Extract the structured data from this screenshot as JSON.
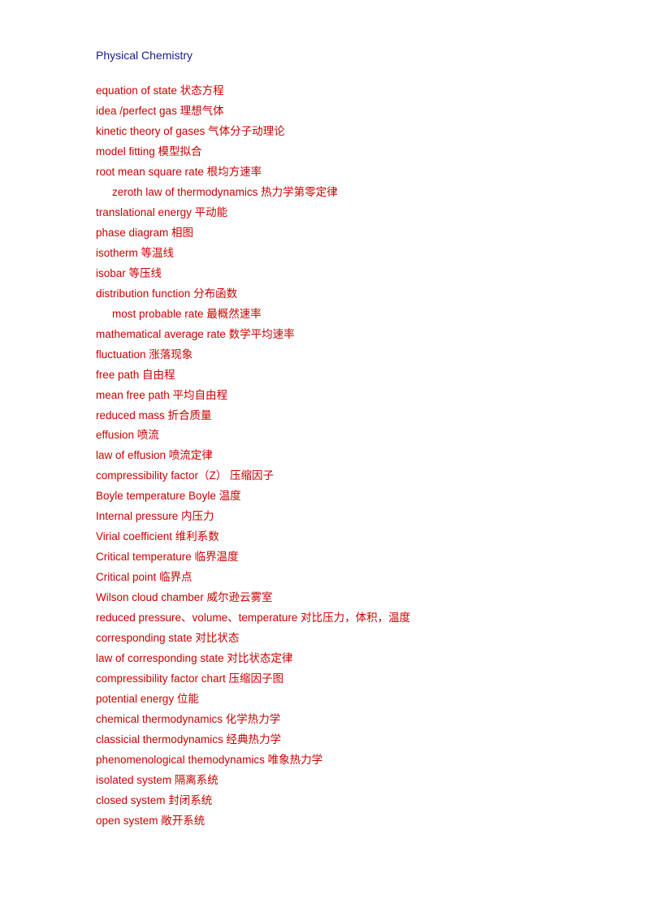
{
  "page": {
    "title": "Physical Chemistry"
  },
  "terms": [
    {
      "en": "equation of state",
      "zh": "状态方程",
      "indent": false,
      "spacing": "wide"
    },
    {
      "en": "idea /perfect gas",
      "zh": "理想气体",
      "indent": false
    },
    {
      "en": "kinetic theory of gases",
      "zh": "气体分子动理论",
      "indent": false
    },
    {
      "en": "model fitting",
      "zh": "模型拟合",
      "indent": false
    },
    {
      "en": "root mean square rate",
      "zh": "根均方速率",
      "indent": false
    },
    {
      "en": "  zeroth law of thermodynamics",
      "zh": "热力学第零定律",
      "indent": true
    },
    {
      "en": "translational energy",
      "zh": "平动能",
      "indent": false
    },
    {
      "en": "phase diagram",
      "zh": "相图",
      "indent": false
    },
    {
      "en": "isotherm",
      "zh": "等温线",
      "indent": false
    },
    {
      "en": "isobar",
      "zh": "等压线",
      "indent": false
    },
    {
      "en": "distribution function",
      "zh": "分布函数",
      "indent": false
    },
    {
      "en": "  most probable rate",
      "zh": "最概然速率",
      "indent": true
    },
    {
      "en": "mathematical average rate",
      "zh": "数学平均速率",
      "indent": false
    },
    {
      "en": "fluctuation",
      "zh": "涨落现象",
      "indent": false
    },
    {
      "en": "free path",
      "zh": "自由程",
      "indent": false
    },
    {
      "en": "mean free path",
      "zh": "平均自由程",
      "indent": false
    },
    {
      "en": "reduced mass",
      "zh": "折合质量",
      "indent": false
    },
    {
      "en": "effusion",
      "zh": "喷流",
      "indent": false
    },
    {
      "en": "law of effusion",
      "zh": "喷流定律",
      "indent": false
    },
    {
      "en": "compressibility factor（Z）",
      "zh": "压缩因子",
      "indent": false
    },
    {
      "en": "Boyle temperature",
      "zh": "Boyle 温度",
      "indent": false,
      "spacing": "wide"
    },
    {
      "en": "Internal pressure",
      "zh": "内压力",
      "indent": false
    },
    {
      "en": "Virial coefficient",
      "zh": "维利系数",
      "indent": false
    },
    {
      "en": "Critical temperature",
      "zh": "临界温度",
      "indent": false
    },
    {
      "en": "Critical point",
      "zh": "临界点",
      "indent": false
    },
    {
      "en": "Wilson cloud chamber",
      "zh": "威尔逊云雾室",
      "indent": false
    },
    {
      "en": "reduced pressure、volume、temperature",
      "zh": "对比压力，体积，温度",
      "indent": false
    },
    {
      "en": "corresponding    state",
      "zh": "对比状态",
      "indent": false
    },
    {
      "en": "law of corresponding state",
      "zh": "对比状态定律",
      "indent": false
    },
    {
      "en": "compressibility factor chart",
      "zh": "压缩因子图",
      "indent": false
    },
    {
      "en": "potential energy",
      "zh": "位能",
      "indent": false
    },
    {
      "en": "chemical    thermodynamics",
      "zh": "化学热力学",
      "indent": false
    },
    {
      "en": "classicial thermodynamics",
      "zh": "经典热力学",
      "indent": false
    },
    {
      "en": "phenomenological themodynamics",
      "zh": "唯象热力学",
      "indent": false
    },
    {
      "en": "isolated    system",
      "zh": "隔离系统",
      "indent": false
    },
    {
      "en": "closed system",
      "zh": "封闭系统",
      "indent": false
    },
    {
      "en": "open system",
      "zh": "敞开系统",
      "indent": false
    }
  ]
}
